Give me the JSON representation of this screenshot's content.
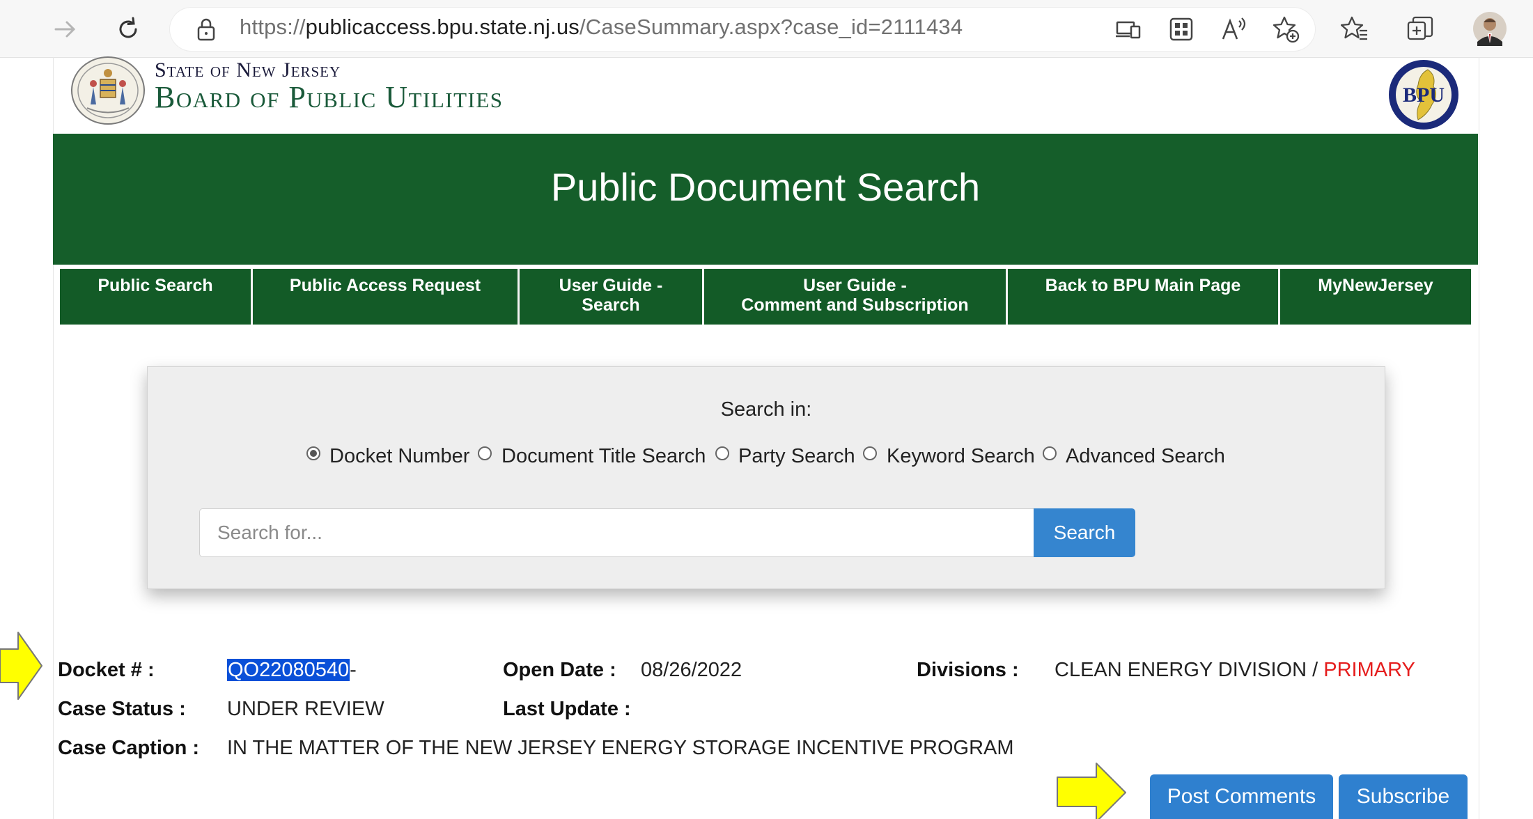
{
  "browser": {
    "url_prefix": "https://",
    "url_domain": "publicaccess.bpu.state.nj.us",
    "url_path": "/CaseSummary.aspx?case_id=2111434"
  },
  "header": {
    "state_text": "State of New Jersey",
    "board_text": "Board of Public Utilities",
    "bpu_logo_text": "BPU"
  },
  "banner": {
    "title": "Public Document Search"
  },
  "nav": [
    {
      "line1": "Public Search",
      "line2": ""
    },
    {
      "line1": "Public Access Request",
      "line2": ""
    },
    {
      "line1": "User Guide -",
      "line2": "Search"
    },
    {
      "line1": "User Guide -",
      "line2": "Comment and Subscription"
    },
    {
      "line1": "Back to BPU Main Page",
      "line2": ""
    },
    {
      "line1": "MyNewJersey",
      "line2": ""
    }
  ],
  "search": {
    "heading": "Search in:",
    "options": [
      "Docket Number",
      "Document Title Search",
      "Party Search",
      "Keyword Search",
      "Advanced Search"
    ],
    "selected": "Docket Number",
    "placeholder": "Search for...",
    "button": "Search"
  },
  "case": {
    "docket_label": "Docket # :",
    "docket_value": "QO22080540",
    "docket_suffix": "-",
    "open_date_label": "Open Date :",
    "open_date_value": "08/26/2022",
    "divisions_label": "Divisions :",
    "divisions_value": "CLEAN ENERGY DIVISION / ",
    "divisions_primary": "PRIMARY",
    "status_label": "Case Status :",
    "status_value": "UNDER REVIEW",
    "last_update_label": "Last Update :",
    "caption_label": "Case Caption :",
    "caption_value": "IN THE MATTER OF THE NEW JERSEY ENERGY STORAGE INCENTIVE PROGRAM"
  },
  "actions": {
    "post_comments": "Post Comments",
    "subscribe": "Subscribe"
  },
  "colors": {
    "banner_green": "#155e2a",
    "button_blue": "#2f80cf",
    "arrow_yellow": "#ffff00",
    "primary_red": "#e51d1d"
  }
}
